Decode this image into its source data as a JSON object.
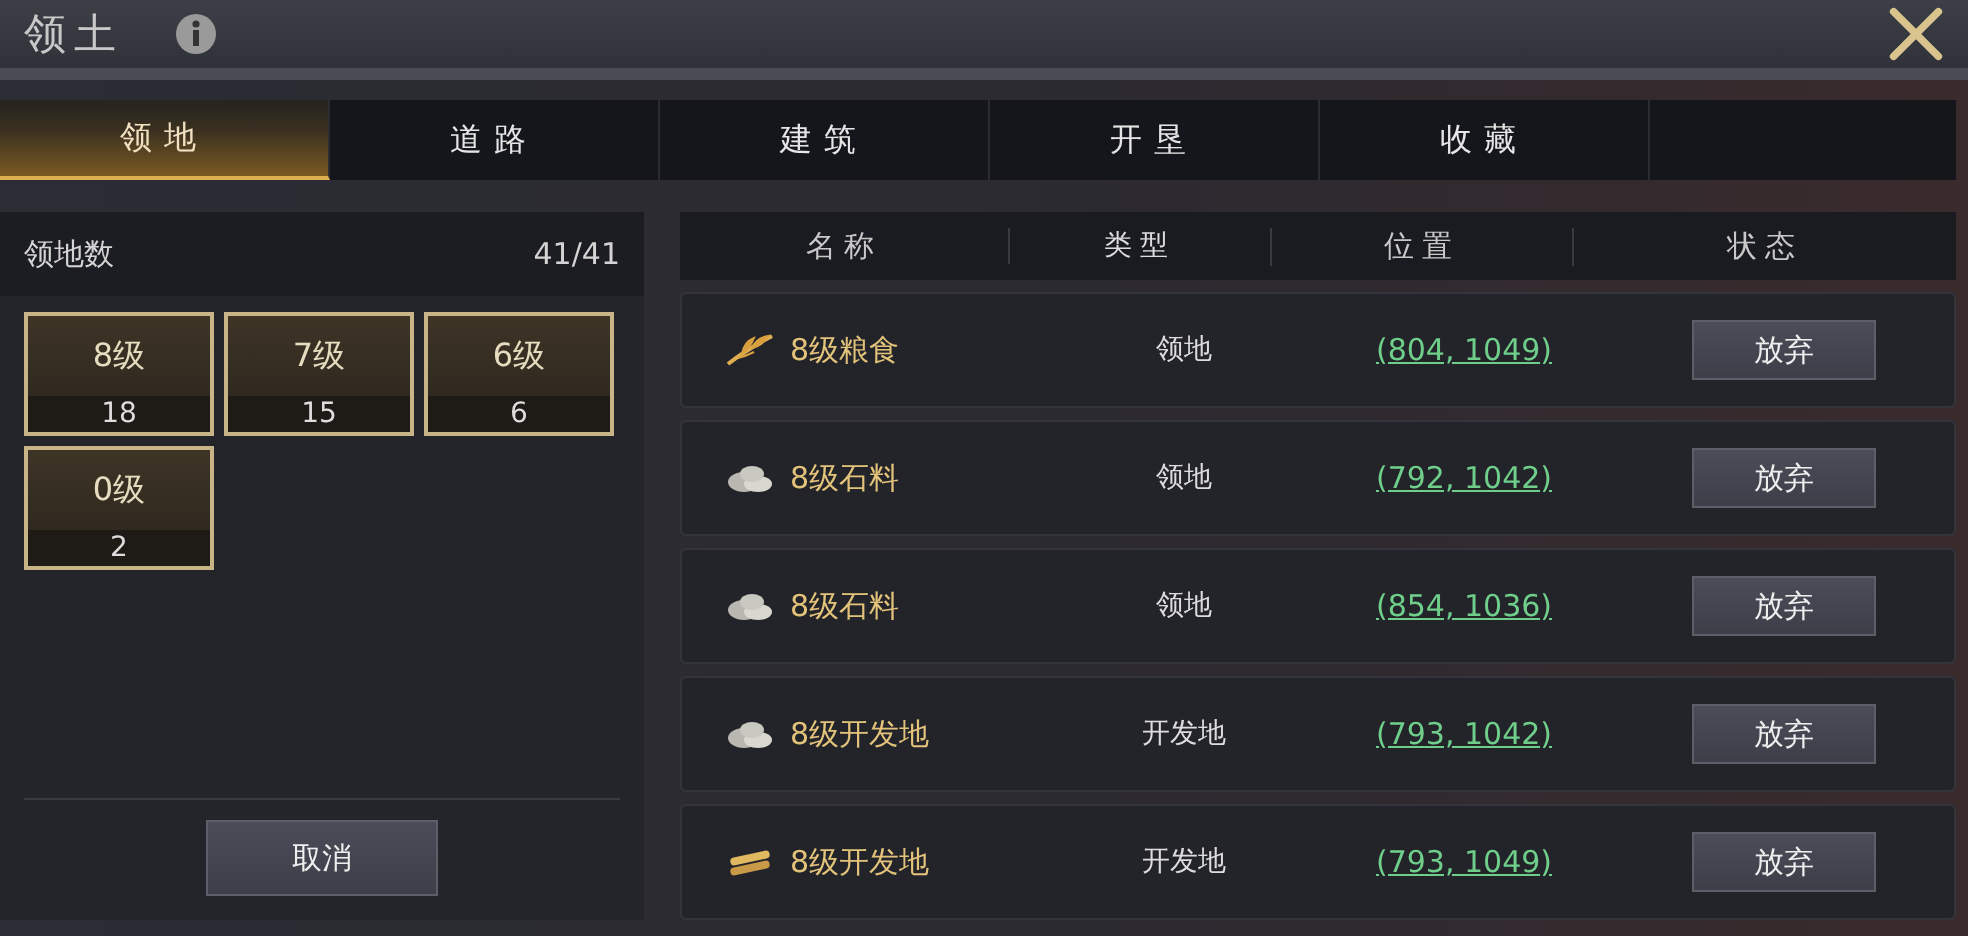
{
  "window": {
    "title": "领土"
  },
  "tabs": [
    {
      "label": "领地",
      "selected": true
    },
    {
      "label": "道路",
      "selected": false
    },
    {
      "label": "建筑",
      "selected": false
    },
    {
      "label": "开垦",
      "selected": false
    },
    {
      "label": "收藏",
      "selected": false
    }
  ],
  "summary": {
    "label": "领地数",
    "count": "41/41"
  },
  "levels": [
    {
      "label": "8级",
      "count": "18"
    },
    {
      "label": "7级",
      "count": "15"
    },
    {
      "label": "6级",
      "count": "6"
    },
    {
      "label": "0级",
      "count": "2"
    }
  ],
  "cancel_button": "取消",
  "table": {
    "columns": [
      "名称",
      "类型",
      "位置",
      "状态"
    ],
    "rows": [
      {
        "kind": "grain",
        "name": "8级粮食",
        "type": "领地",
        "position": "(804, 1049)",
        "action": "放弃"
      },
      {
        "kind": "stone",
        "name": "8级石料",
        "type": "领地",
        "position": "(792, 1042)",
        "action": "放弃"
      },
      {
        "kind": "stone",
        "name": "8级石料",
        "type": "领地",
        "position": "(854, 1036)",
        "action": "放弃"
      },
      {
        "kind": "stone",
        "name": "8级开发地",
        "type": "开发地",
        "position": "(793, 1042)",
        "action": "放弃"
      },
      {
        "kind": "wood",
        "name": "8级开发地",
        "type": "开发地",
        "position": "(793, 1049)",
        "action": "放弃"
      }
    ]
  }
}
